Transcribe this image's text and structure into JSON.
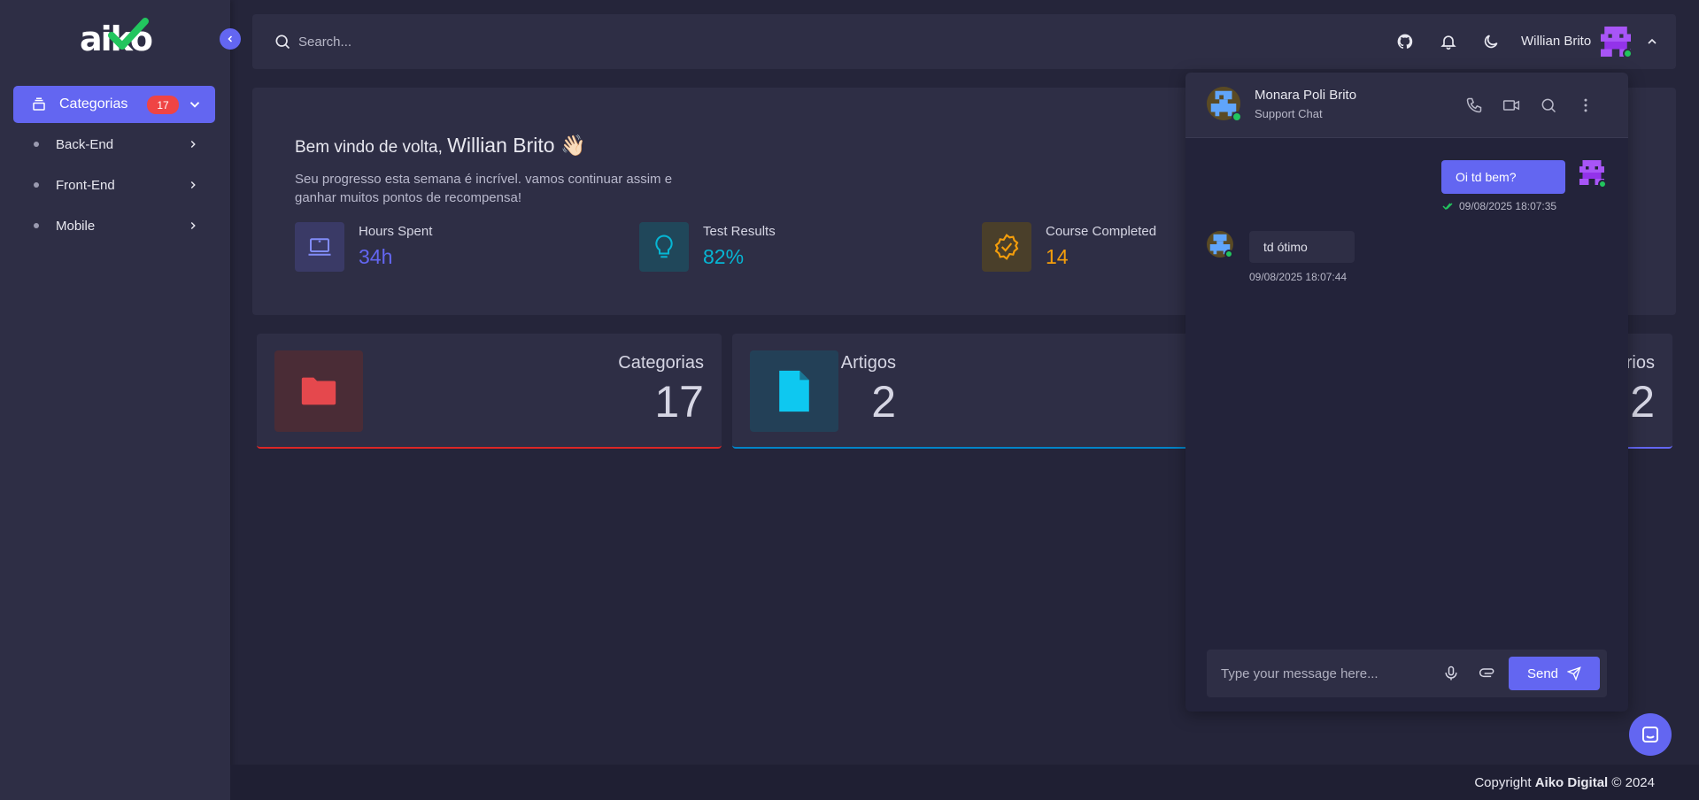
{
  "brand": {
    "logo_text": "aiko"
  },
  "sidebar": {
    "active": {
      "label": "Categorias",
      "badge": "17",
      "icon": "layers-icon"
    },
    "items": [
      {
        "label": "Back-End"
      },
      {
        "label": "Front-End"
      },
      {
        "label": "Mobile"
      }
    ]
  },
  "topbar": {
    "search_placeholder": "Search...",
    "user_name": "Willian Brito",
    "icons": [
      "github-icon",
      "bell-icon",
      "moon-icon",
      "chevron-up-icon"
    ]
  },
  "welcome": {
    "greeting": "Bem vindo de volta,",
    "name": "Willian Brito 👋🏻",
    "subtitle": "Seu progresso esta semana é incrível. vamos continuar assim e ganhar muitos pontos de recompensa!",
    "stats": [
      {
        "label": "Hours Spent",
        "value": "34h",
        "color": "#6366f1",
        "icon": "laptop-icon"
      },
      {
        "label": "Test Results",
        "value": "82%",
        "color": "#06b6d4",
        "icon": "lightbulb-icon"
      },
      {
        "label": "Course Completed",
        "value": "14",
        "color": "#f59e0b",
        "icon": "badge-check-icon"
      }
    ]
  },
  "cards": [
    {
      "title": "Categorias",
      "value": "17",
      "color": "#ef4444",
      "icon": "folder-icon"
    },
    {
      "title": "Artigos",
      "value": "2",
      "color": "#0ea5e9",
      "icon": "file-icon"
    },
    {
      "title": "rios",
      "value": "2",
      "color": "#6366f1"
    }
  ],
  "chat": {
    "contact_name": "Monara Poli Brito",
    "contact_sub": "Support Chat",
    "messages": [
      {
        "text": "Oi td bem?",
        "time": "09/08/2025 18:07:35",
        "direction": "out"
      },
      {
        "text": "td ótimo",
        "time": "09/08/2025 18:07:44",
        "direction": "in"
      }
    ],
    "input_placeholder": "Type your message here...",
    "send_label": "Send"
  },
  "footer": {
    "prefix": "Copyright ",
    "company": "Aiko Digital",
    "suffix": " © 2024"
  }
}
